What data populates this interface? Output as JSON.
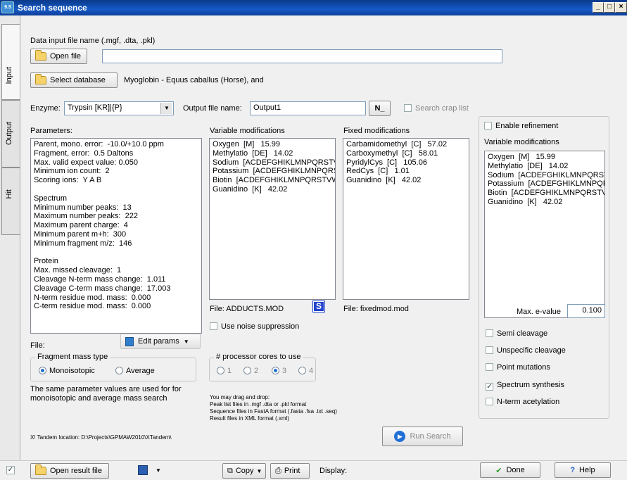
{
  "window": {
    "title": "Search sequence",
    "app_icon": "9.5"
  },
  "tabs": [
    {
      "label": "Input"
    },
    {
      "label": "Output"
    },
    {
      "label": "Hit"
    }
  ],
  "datafile": {
    "label": "Data input file name (.mgf, .dta, .pkl)",
    "open_button": "Open file",
    "value": ""
  },
  "database": {
    "button": "Select database",
    "selected": "Myoglobin - Equus caballus (Horse), and"
  },
  "enzyme": {
    "label": "Enzyme:",
    "value": "Trypsin  [KR]|{P}"
  },
  "output": {
    "label": "Output file name:",
    "value": "Output1",
    "n_button": "N_",
    "crap_label": "Search crap list"
  },
  "parameters": {
    "label": "Parameters:",
    "text": "Parent, mono. error:  -10.0/+10.0 ppm\nFragment, error:  0.5 Daltons\nMax. valid expect value: 0.050\nMinimum ion count:  2\nScoring ions:  Y A B\n\nSpectrum\nMinimum number peaks:  13\nMaximum number peaks:  222\nMaximum parent charge:  4\nMinimum parent m+h:  300\nMinimum fragment m/z:  146\n\nProtein\nMax. missed cleavage:  1\nCleavage N-term mass change:  1.011\nCleavage C-term mass change:  17.003\nN-term residue mod. mass:  0.000\nC-term residue mod. mass:  0.000",
    "file_label": "File:",
    "edit_button": "Edit params"
  },
  "varmods": {
    "label": "Variable modifications",
    "text": "Oxygen  [M]   15.99\nMethylatio  [DE]   14.02\nSodium  [ACDEFGHIKLMNPQRSTVWY\nPotassium  [ACDEFGHIKLMNPQRSTVWY\nBiotin  [ACDEFGHIKLMNPQRSTVWY\nGuanidino  [K]   42.02",
    "file": "File: ADDUCTS.MOD",
    "s_badge": "S",
    "noise_label": "Use noise suppression"
  },
  "fixedmods": {
    "label": "Fixed modifications",
    "text": "Carbamidomethyl  [C]   57.02\nCarboxymethyl  [C]   58.01\nPyridylCys  [C]   105.06\nRedCys  [C]   1.01\nGuanidino  [K]   42.02",
    "file": "File: fixedmod.mod"
  },
  "refinement": {
    "enable_label": "Enable refinement",
    "varmods_label": "Variable modifications",
    "text": "Oxygen  [M]   15.99\nMethylatio  [DE]   14.02\nSodium  [ACDEFGHIKLMNPQRSTVWY\nPotassium  [ACDEFGHIKLMNPQRSTVWY\nBiotin  [ACDEFGHIKLMNPQRSTVWY\nGuanidino  [K]   42.02",
    "evalue_label": "Max. e-value",
    "evalue": "0.100",
    "options": [
      {
        "label": "Semi cleavage",
        "checked": false
      },
      {
        "label": "Unspecific cleavage",
        "checked": false
      },
      {
        "label": "Point mutations",
        "checked": false
      },
      {
        "label": "Spectrum synthesis",
        "checked": true
      },
      {
        "label": "N-term acetylation",
        "checked": false
      }
    ]
  },
  "masstype": {
    "legend": "Fragment mass type",
    "options": [
      "Monoisotopic",
      "Average"
    ],
    "selected": "Monoisotopic",
    "note": "The same parameter values are used for for\nmonoisotopic and average mass search"
  },
  "cores": {
    "legend": "# processor cores to use",
    "options": [
      "1",
      "2",
      "3",
      "4"
    ],
    "selected": "3"
  },
  "dragdrop": "You may drag and drop:\nPeak list files in .mgf .dta or .pkl format\nSequence files in FastA format (.fasta .fsa .txt .seq)\nResult files in XML format (.xml)",
  "tandem_location": "X! Tandem location: D:\\Projects\\GPMAW2010\\XTandem\\",
  "run_button": "Run Search",
  "bottom": {
    "open_result": "Open result file",
    "copy": "Copy",
    "print": "Print",
    "display": "Display:",
    "done": "Done",
    "help": "Help"
  }
}
